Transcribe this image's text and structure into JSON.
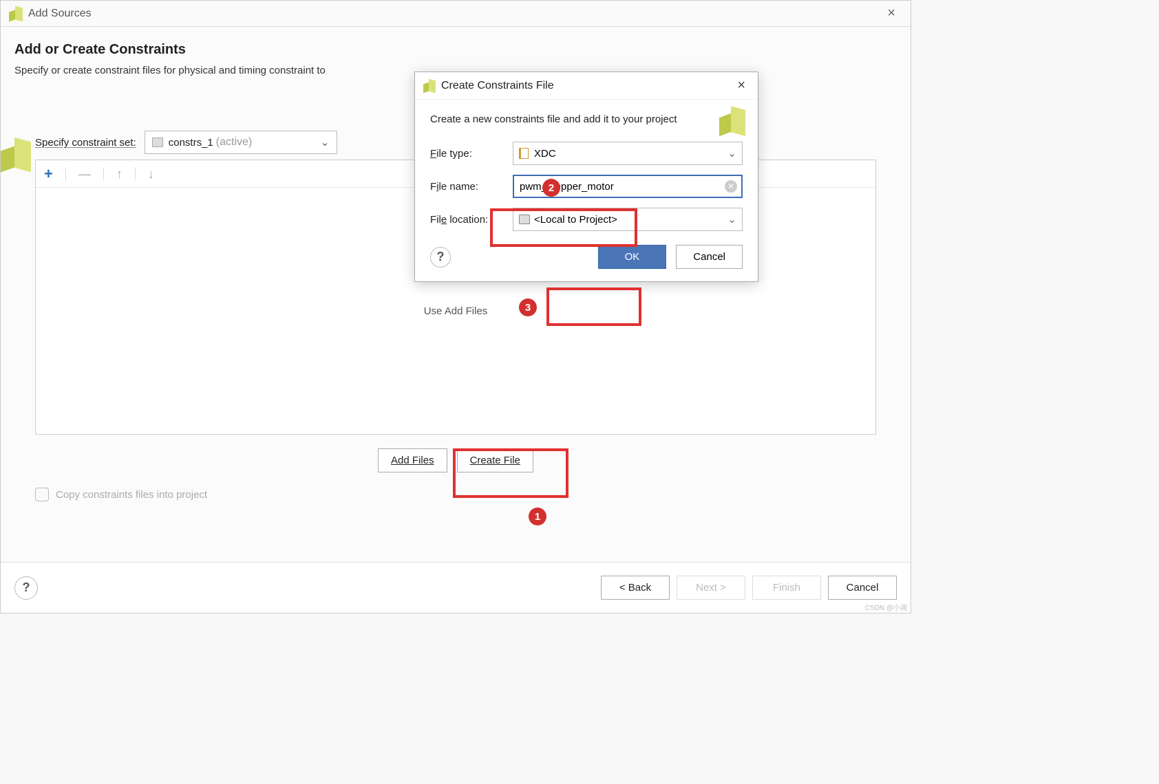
{
  "window": {
    "title": "Add Sources",
    "close": "×"
  },
  "page": {
    "heading": "Add or Create Constraints",
    "subheading": "Specify or create constraint files for physical and timing constraint to",
    "specify_label": "Specify constraint set:",
    "constraint_set_value": "constrs_1",
    "constraint_set_tag": "(active)",
    "empty_text": "Use Add Files",
    "add_files_btn": "Add Files",
    "create_file_btn": "Create File",
    "copy_checkbox_label": "Copy constraints files into project"
  },
  "toolbar": {
    "plus": "+",
    "minus": "—",
    "up": "↑",
    "down": "↓"
  },
  "footer": {
    "help": "?",
    "back": "< Back",
    "next": "Next >",
    "finish": "Finish",
    "cancel": "Cancel"
  },
  "modal": {
    "title": "Create Constraints File",
    "close": "×",
    "desc": "Create a new constraints file and add it to your project",
    "file_type_label": "File type:",
    "file_type_value": "XDC",
    "file_name_label": "File name:",
    "file_name_value": "pwm_stepper_motor",
    "file_location_label": "File location:",
    "file_location_value": "<Local to Project>",
    "help": "?",
    "ok": "OK",
    "cancel": "Cancel"
  },
  "annotations": {
    "b1": "1",
    "b2": "2",
    "b3": "3"
  },
  "watermark": "CSDN @小润"
}
